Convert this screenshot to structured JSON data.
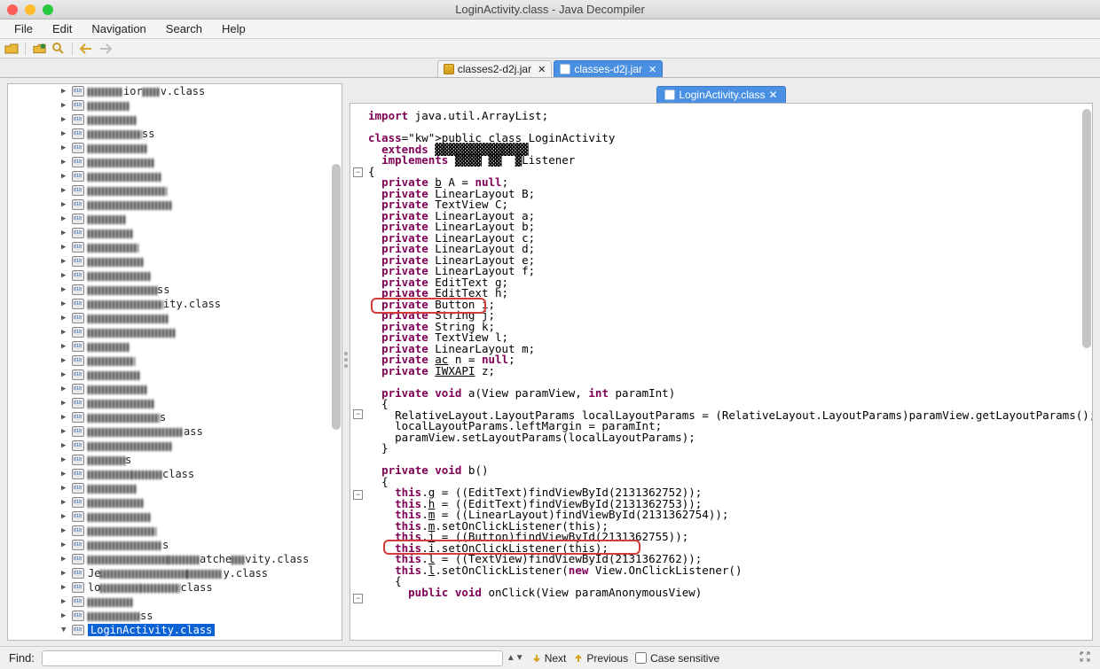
{
  "window": {
    "title": "LoginActivity.class - Java Decompiler"
  },
  "menubar": {
    "items": [
      "File",
      "Edit",
      "Navigation",
      "Search",
      "Help"
    ]
  },
  "jar_tabs": [
    {
      "label": "classes2-d2j.jar",
      "active": false
    },
    {
      "label": "classes-d2j.jar",
      "active": true
    }
  ],
  "code_tab": {
    "label": "LoginActivity.class"
  },
  "tree": {
    "items": [
      {
        "suffix": "ior",
        "suffix2": "v.class"
      },
      {},
      {},
      {
        "suffix": "ss"
      },
      {},
      {},
      {},
      {},
      {},
      {},
      {},
      {},
      {},
      {},
      {
        "suffix": "ss"
      },
      {
        "suffix": "ity.class",
        "prefixLen": 1
      },
      {},
      {},
      {},
      {},
      {},
      {},
      {},
      {
        "suffix": "s"
      },
      {
        "suffix2": "ass"
      },
      {},
      {
        "suffix": "s"
      },
      {
        "suffix2": "class",
        "doubleIcon": true
      },
      {},
      {},
      {},
      {},
      {
        "suffix": "s"
      },
      {
        "suffix2": "atche",
        "suffix3": "vity.class"
      },
      {
        "suffix2": "y.class",
        "prefix": "Je"
      },
      {
        "suffix2": "class",
        "prefix": "lo"
      },
      {},
      {
        "suffix": "ss"
      }
    ],
    "selected_label": "LoginActivity.class"
  },
  "code": {
    "lines": [
      {
        "t": "import java.util.ArrayList;",
        "kw": [
          "import"
        ]
      },
      {
        "t": ""
      },
      {
        "t": "public class LoginActivity",
        "kw": [
          "public",
          "class"
        ]
      },
      {
        "t": "  extends ▓▓▓▓▓▓▓▓▓▓▓▓▓▓",
        "kw": [
          "extends"
        ]
      },
      {
        "t": "  implements ▓▓▓▓ ▓▓  ▓Listener",
        "kw": [
          "implements"
        ]
      },
      {
        "t": "{"
      },
      {
        "t": "  private b A = null;",
        "kw": [
          "private",
          "null"
        ],
        "u": [
          "b"
        ]
      },
      {
        "t": "  private LinearLayout B;",
        "kw": [
          "private"
        ]
      },
      {
        "t": "  private TextView C;",
        "kw": [
          "private"
        ]
      },
      {
        "t": "  private LinearLayout a;",
        "kw": [
          "private"
        ]
      },
      {
        "t": "  private LinearLayout b;",
        "kw": [
          "private"
        ]
      },
      {
        "t": "  private LinearLayout c;",
        "kw": [
          "private"
        ]
      },
      {
        "t": "  private LinearLayout d;",
        "kw": [
          "private"
        ]
      },
      {
        "t": "  private LinearLayout e;",
        "kw": [
          "private"
        ]
      },
      {
        "t": "  private LinearLayout f;",
        "kw": [
          "private"
        ]
      },
      {
        "t": "  private EditText g;",
        "kw": [
          "private"
        ]
      },
      {
        "t": "  private EditText h;",
        "kw": [
          "private"
        ]
      },
      {
        "t": "  private Button i;",
        "kw": [
          "private"
        ],
        "hl": 1
      },
      {
        "t": "  private String j;",
        "kw": [
          "private"
        ]
      },
      {
        "t": "  private String k;",
        "kw": [
          "private"
        ]
      },
      {
        "t": "  private TextView l;",
        "kw": [
          "private"
        ]
      },
      {
        "t": "  private LinearLayout m;",
        "kw": [
          "private"
        ]
      },
      {
        "t": "  private ac n = null;",
        "kw": [
          "private",
          "null"
        ],
        "u": [
          "ac"
        ]
      },
      {
        "t": "  private IWXAPI z;",
        "kw": [
          "private"
        ],
        "u": [
          "IWXAPI"
        ]
      },
      {
        "t": "  "
      },
      {
        "t": "  private void a(View paramView, int paramInt)",
        "kw": [
          "private",
          "void",
          "int"
        ]
      },
      {
        "t": "  {"
      },
      {
        "t": "    RelativeLayout.LayoutParams localLayoutParams = (RelativeLayout.LayoutParams)paramView.getLayoutParams();"
      },
      {
        "t": "    localLayoutParams.leftMargin = paramInt;"
      },
      {
        "t": "    paramView.setLayoutParams(localLayoutParams);"
      },
      {
        "t": "  }"
      },
      {
        "t": "  "
      },
      {
        "t": "  private void b()",
        "kw": [
          "private",
          "void"
        ]
      },
      {
        "t": "  {"
      },
      {
        "t": "    this.g = ((EditText)findViewById(2131362752));",
        "kw": [
          "this"
        ],
        "u": [
          "g"
        ]
      },
      {
        "t": "    this.h = ((EditText)findViewById(2131362753));",
        "kw": [
          "this"
        ],
        "u": [
          "h"
        ]
      },
      {
        "t": "    this.m = ((LinearLayout)findViewById(2131362754));",
        "kw": [
          "this"
        ],
        "u": [
          "m"
        ]
      },
      {
        "t": "    this.m.setOnClickListener(this);",
        "kw": [
          "this",
          "this"
        ],
        "u": [
          "m"
        ]
      },
      {
        "t": "    this.i = ((Button)findViewById(2131362755));",
        "kw": [
          "this"
        ],
        "u": [
          "i"
        ],
        "hl": 2
      },
      {
        "t": "    this.i.setOnClickListener(this);",
        "kw": [
          "this",
          "this"
        ],
        "u": [
          "i"
        ]
      },
      {
        "t": "    this.l = ((TextView)findViewById(2131362762));",
        "kw": [
          "this"
        ],
        "u": [
          "l"
        ]
      },
      {
        "t": "    this.l.setOnClickListener(new View.OnClickListener()",
        "kw": [
          "this",
          "new"
        ],
        "u": [
          "l"
        ]
      },
      {
        "t": "    {"
      },
      {
        "t": "      public void onClick(View paramAnonymousView)",
        "kw": [
          "public",
          "void"
        ]
      }
    ]
  },
  "findbar": {
    "label": "Find:",
    "next": "Next",
    "previous": "Previous",
    "case_sensitive": "Case sensitive"
  }
}
